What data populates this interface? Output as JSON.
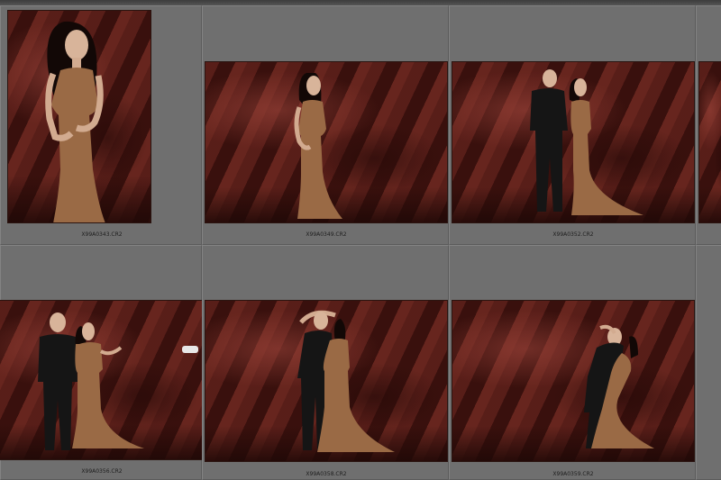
{
  "grid": {
    "row1": [
      {
        "filename": "X99A0343.CR2",
        "orientation": "portrait"
      },
      {
        "filename": "X99A0349.CR2",
        "orientation": "landscape"
      },
      {
        "filename": "X99A0352.CR2",
        "orientation": "landscape"
      }
    ],
    "row2": [
      {
        "filename": "X99A0356.CR2",
        "orientation": "landscape"
      },
      {
        "filename": "X99A0358.CR2",
        "orientation": "landscape"
      },
      {
        "filename": "X99A0359.CR2",
        "orientation": "landscape"
      }
    ]
  },
  "colors": {
    "grid_background": "#6f6f6f",
    "backdrop": "#4a1a15",
    "dress": "#9a6a45",
    "suit": "#151515"
  }
}
